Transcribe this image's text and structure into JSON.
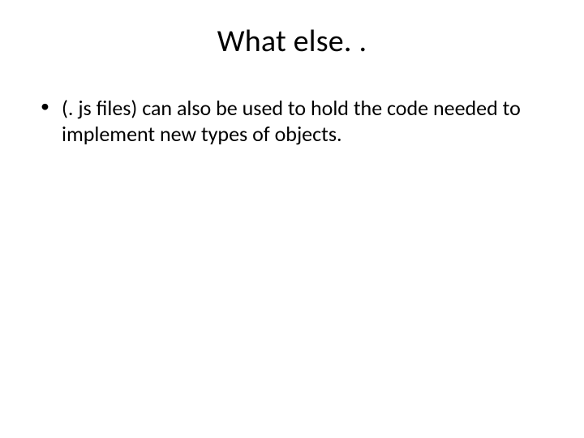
{
  "slide": {
    "title": "What else. .",
    "bullets": [
      "(. js files) can also be used to hold the code needed to implement new types of objects."
    ]
  }
}
